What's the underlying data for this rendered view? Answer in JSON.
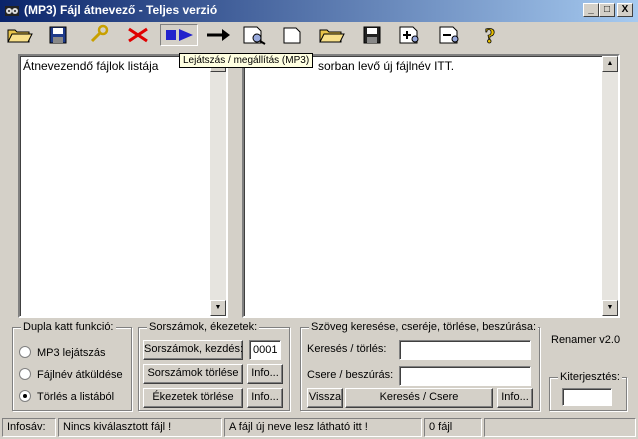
{
  "window": {
    "title": "(MP3)  Fájl átnevező  -  Teljes verzió",
    "minimize": "_",
    "maximize": "□",
    "close": "X"
  },
  "toolbar": {
    "tooltip": "Lejátszás / megállítás (MP3)",
    "items": [
      {
        "icon": "open-folder-icon"
      },
      {
        "icon": "save-disk-icon"
      },
      {
        "icon": "wrench-icon"
      },
      {
        "icon": "red-x-icon"
      },
      {
        "icon": "play-stop-icon"
      },
      {
        "icon": "right-arrow-icon"
      },
      {
        "icon": "preview-page-icon"
      },
      {
        "icon": "blank-page-icon"
      },
      {
        "icon": "open-folder-icon"
      },
      {
        "icon": "save-disk-icon"
      },
      {
        "icon": "add-page-icon"
      },
      {
        "icon": "remove-page-icon"
      },
      {
        "icon": "help-icon"
      }
    ]
  },
  "left_list": {
    "text": "Átnevezendő fájlok listája"
  },
  "right_list": {
    "text": "sorban levő új fájlnév ITT."
  },
  "double_click": {
    "legend": "Dupla katt funkció:",
    "options": [
      {
        "label": "MP3 lejátszás",
        "selected": false
      },
      {
        "label": "Fájlnév átküldése",
        "selected": false
      },
      {
        "label": "Törlés a listából",
        "selected": true
      }
    ]
  },
  "numbering": {
    "legend": "Sorszámok, ékezetek:",
    "start_button": "Sorszámok, kezdés:",
    "start_value": "0001",
    "delete_numbers_button": "Sorszámok törlése",
    "delete_accents_button": "Ékezetek törlése",
    "info1": "Info...",
    "info2": "Info..."
  },
  "search": {
    "legend": "Szöveg keresése, cseréje, törlése, beszúrása:",
    "search_label": "Keresés / törlés:",
    "search_value": "",
    "replace_label": "Csere / beszúrás:",
    "replace_value": "",
    "back_button": "Vissza",
    "search_replace_button": "Keresés / Csere",
    "info": "Info..."
  },
  "version": "Renamer v2.0",
  "extension": {
    "legend": "Kiterjesztés:",
    "value": ""
  },
  "status": {
    "label": "Infosáv:",
    "cell1": "Nincs kiválasztott fájl !",
    "cell2": "A fájl új neve lesz látható itt !",
    "cell3": "0 fájl",
    "cell4": ""
  }
}
